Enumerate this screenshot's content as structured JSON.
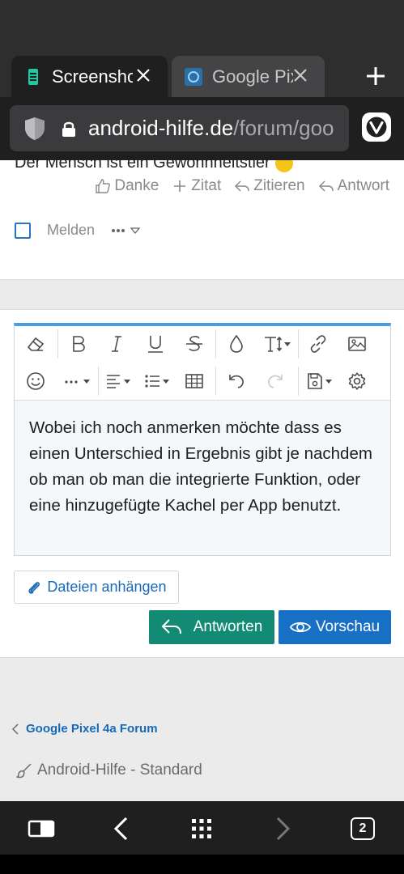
{
  "browser": {
    "tabs": [
      {
        "title": "Screenshot",
        "active": true
      },
      {
        "title": "Google Pixel",
        "active": false
      }
    ],
    "url_host": "android-hilfe.de",
    "url_path": "/forum/goo",
    "tab_count": "2"
  },
  "post": {
    "text": "Der Mensch ist ein Gewohnheitstier",
    "actions": {
      "thanks": "Danke",
      "quote": "Zitat",
      "cite": "Zitieren",
      "reply": "Antwort"
    },
    "report": "Melden"
  },
  "editor": {
    "content": "Wobei ich noch anmerken möchte dass es einen Unterschied in Ergebnis gibt je nachdem ob man ob man die integrierte Funktion, oder eine hinzugefügte Kachel per App benutzt."
  },
  "buttons": {
    "attach": "Dateien anhängen",
    "answer": "Antworten",
    "preview": "Vorschau"
  },
  "breadcrumb": "Google Pixel 4a Forum",
  "style_chooser": "Android-Hilfe - Standard",
  "colors": {
    "accent_blue": "#1870c5",
    "answer_green": "#138a74",
    "editor_border_top": "#4a9dde",
    "browser_dark": "#1f1f20"
  }
}
